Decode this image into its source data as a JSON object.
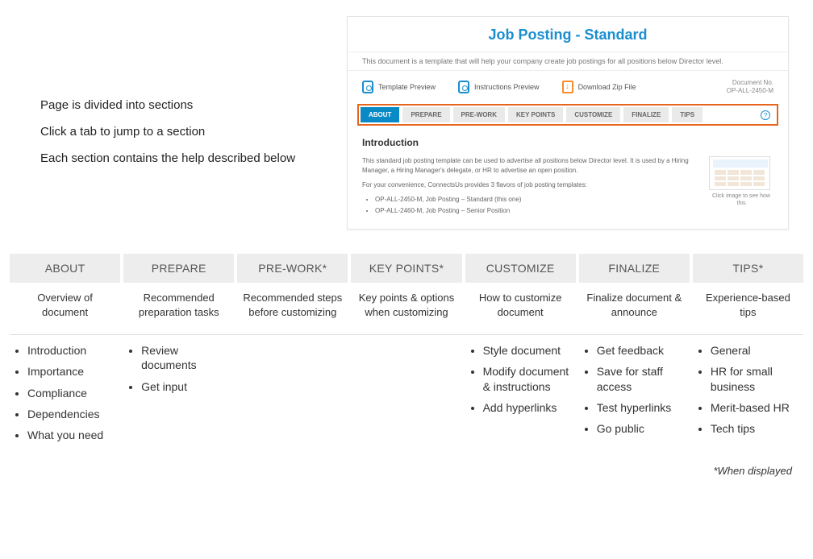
{
  "leftNotes": [
    "Page is divided into sections",
    "Click a tab to jump to a section",
    "Each section contains the help described below"
  ],
  "preview": {
    "title": "Job Posting - Standard",
    "description": "This document is a template that will help your company create job postings for all positions below Director level.",
    "actions": {
      "templatePreview": "Template Preview",
      "instructionsPreview": "Instructions Preview",
      "downloadZip": "Download Zip File"
    },
    "docNoLabel": "Document No.",
    "docNo": "OP-ALL-2450-M",
    "tabs": [
      "ABOUT",
      "PREPARE",
      "PRE-WORK",
      "KEY POINTS",
      "CUSTOMIZE",
      "FINALIZE",
      "TIPS"
    ],
    "introHeading": "Introduction",
    "introP1": "This standard job posting template can be used to advertise all positions below Director level. It is used by a Hiring Manager, a Hiring Manager's delegate, or HR to advertise an open position.",
    "introP2": "For your convenience, ConnectsUs provides 3 flavors of job posting templates:",
    "introLi1": "OP-ALL-2450-M, Job Posting – Standard (this one)",
    "introLi2": "OP-ALL-2460-M, Job Posting – Senior Position",
    "thumbCaption": "Click image to see how this"
  },
  "sections": [
    {
      "head": "ABOUT",
      "sub": "Overview of document",
      "items": [
        "Introduction",
        "Importance",
        "Compliance",
        "Dependencies",
        "What you need"
      ]
    },
    {
      "head": "PREPARE",
      "sub": "Recommended preparation tasks",
      "items": [
        "Review documents",
        "Get input"
      ]
    },
    {
      "head": "PRE-WORK*",
      "sub": "Recommended steps before customizing",
      "items": []
    },
    {
      "head": "KEY POINTS*",
      "sub": "Key points & options when customizing",
      "items": []
    },
    {
      "head": "CUSTOMIZE",
      "sub": "How to customize document",
      "items": [
        "Style document",
        "Modify document & instructions",
        "Add hyperlinks"
      ]
    },
    {
      "head": "FINALIZE",
      "sub": "Finalize document & announce",
      "items": [
        "Get feedback",
        "Save for staff access",
        "Test hyperlinks",
        "Go public"
      ]
    },
    {
      "head": "TIPS*",
      "sub": "Experience-based tips",
      "items": [
        "General",
        "HR for small business",
        "Merit-based HR",
        "Tech tips"
      ]
    }
  ],
  "footnote": "*When displayed"
}
